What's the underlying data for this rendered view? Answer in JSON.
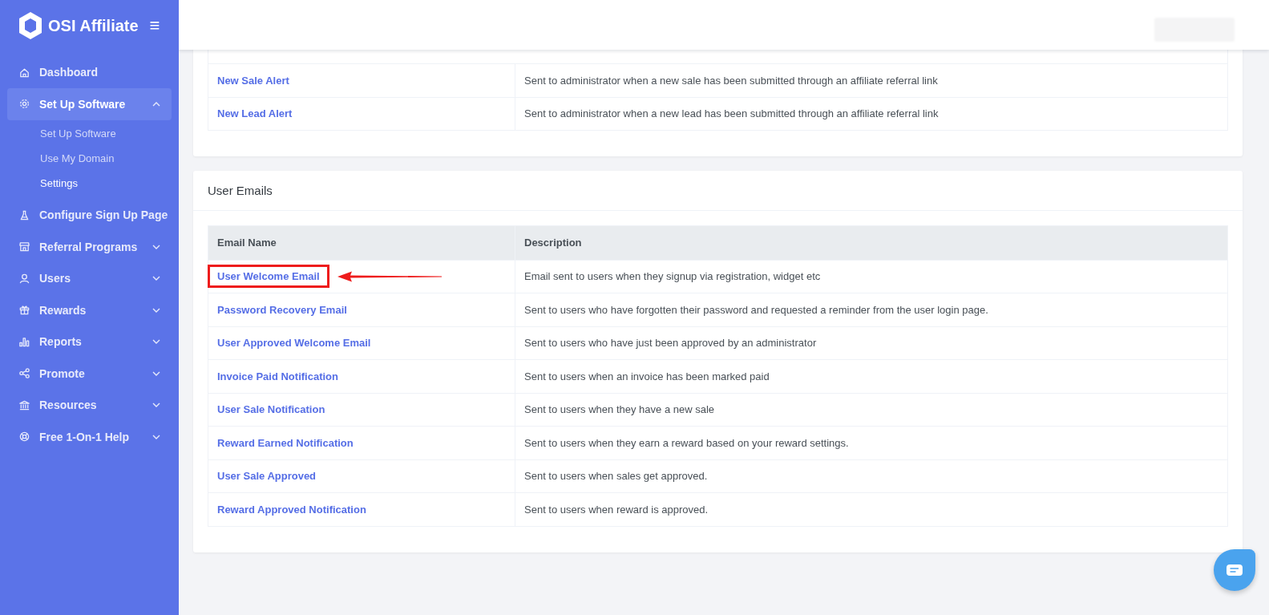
{
  "sidebar": {
    "brand": "OSI Affiliate",
    "menu_button": "≡",
    "items": [
      {
        "label": "Dashboard",
        "kind": "link",
        "selected": false
      },
      {
        "label": "Set Up Software",
        "kind": "group",
        "selected": true,
        "expanded": true,
        "children": [
          {
            "label": "Set Up Software",
            "selected": false
          },
          {
            "label": "Use My Domain",
            "selected": false
          },
          {
            "label": "Settings",
            "selected": true
          }
        ]
      },
      {
        "label": "Configure Sign Up Page",
        "kind": "link",
        "selected": false
      },
      {
        "label": "Referral Programs",
        "kind": "group",
        "selected": false,
        "expanded": false
      },
      {
        "label": "Users",
        "kind": "group",
        "selected": false,
        "expanded": false
      },
      {
        "label": "Rewards",
        "kind": "group",
        "selected": false,
        "expanded": false
      },
      {
        "label": "Reports",
        "kind": "group",
        "selected": false,
        "expanded": false
      },
      {
        "label": "Promote",
        "kind": "group",
        "selected": false,
        "expanded": false
      },
      {
        "label": "Resources",
        "kind": "group",
        "selected": false,
        "expanded": false
      },
      {
        "label": "Free 1-On-1 Help",
        "kind": "group",
        "selected": false,
        "expanded": false
      }
    ]
  },
  "admin_emails": {
    "rows": [
      {
        "name": "New Sale Alert",
        "description": "Sent to administrator when a new sale has been submitted through an affiliate referral link"
      },
      {
        "name": "New Lead Alert",
        "description": "Sent to administrator when a new lead has been submitted through an affiliate referral link"
      }
    ]
  },
  "user_emails": {
    "title": "User Emails",
    "columns": [
      "Email Name",
      "Description"
    ],
    "rows": [
      {
        "name": "User Welcome Email",
        "description": "Email sent to users when they signup via registration, widget etc",
        "highlighted": true
      },
      {
        "name": "Password Recovery Email",
        "description": "Sent to users who have forgotten their password and requested a reminder from the user login page.",
        "highlighted": false
      },
      {
        "name": "User Approved Welcome Email",
        "description": "Sent to users who have just been approved by an administrator",
        "highlighted": false
      },
      {
        "name": "Invoice Paid Notification",
        "description": "Sent to users when an invoice has been marked paid",
        "highlighted": false
      },
      {
        "name": "User Sale Notification",
        "description": "Sent to users when they have a new sale",
        "highlighted": false
      },
      {
        "name": "Reward Earned Notification",
        "description": "Sent to users when they earn a reward based on your reward settings.",
        "highlighted": false
      },
      {
        "name": "User Sale Approved",
        "description": "Sent to users when sales get approved.",
        "highlighted": false
      },
      {
        "name": "Reward Approved Notification",
        "description": "Sent to users when reward is approved.",
        "highlighted": false
      }
    ]
  }
}
